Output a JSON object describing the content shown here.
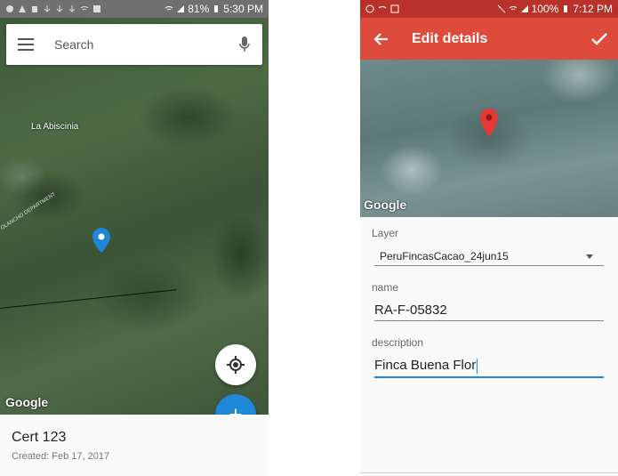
{
  "left_screen": {
    "status_bar": {
      "battery": "81%",
      "time": "5:30 PM"
    },
    "search": {
      "placeholder": "Search"
    },
    "map": {
      "place_label": "La Abiscinia",
      "region_label": "OLANCHO DEPARTMENT",
      "attribution": "Google"
    },
    "bottom_sheet": {
      "title": "Cert 123",
      "subtitle": "Created: Feb 17, 2017"
    },
    "fab_add_label": "+"
  },
  "right_screen": {
    "status_bar": {
      "battery": "100%",
      "time": "7:12 PM"
    },
    "toolbar": {
      "title": "Edit details"
    },
    "map": {
      "attribution": "Google"
    },
    "form": {
      "layer_label": "Layer",
      "layer_value": "PeruFincasCacao_24jun15",
      "name_label": "name",
      "name_value": "RA-F-05832",
      "description_label": "description",
      "description_value": "Finca Buena Flor"
    }
  },
  "colors": {
    "toolbar_red": "#de4b3a",
    "status_red": "#b8322a",
    "accent_blue": "#1e88d8"
  }
}
